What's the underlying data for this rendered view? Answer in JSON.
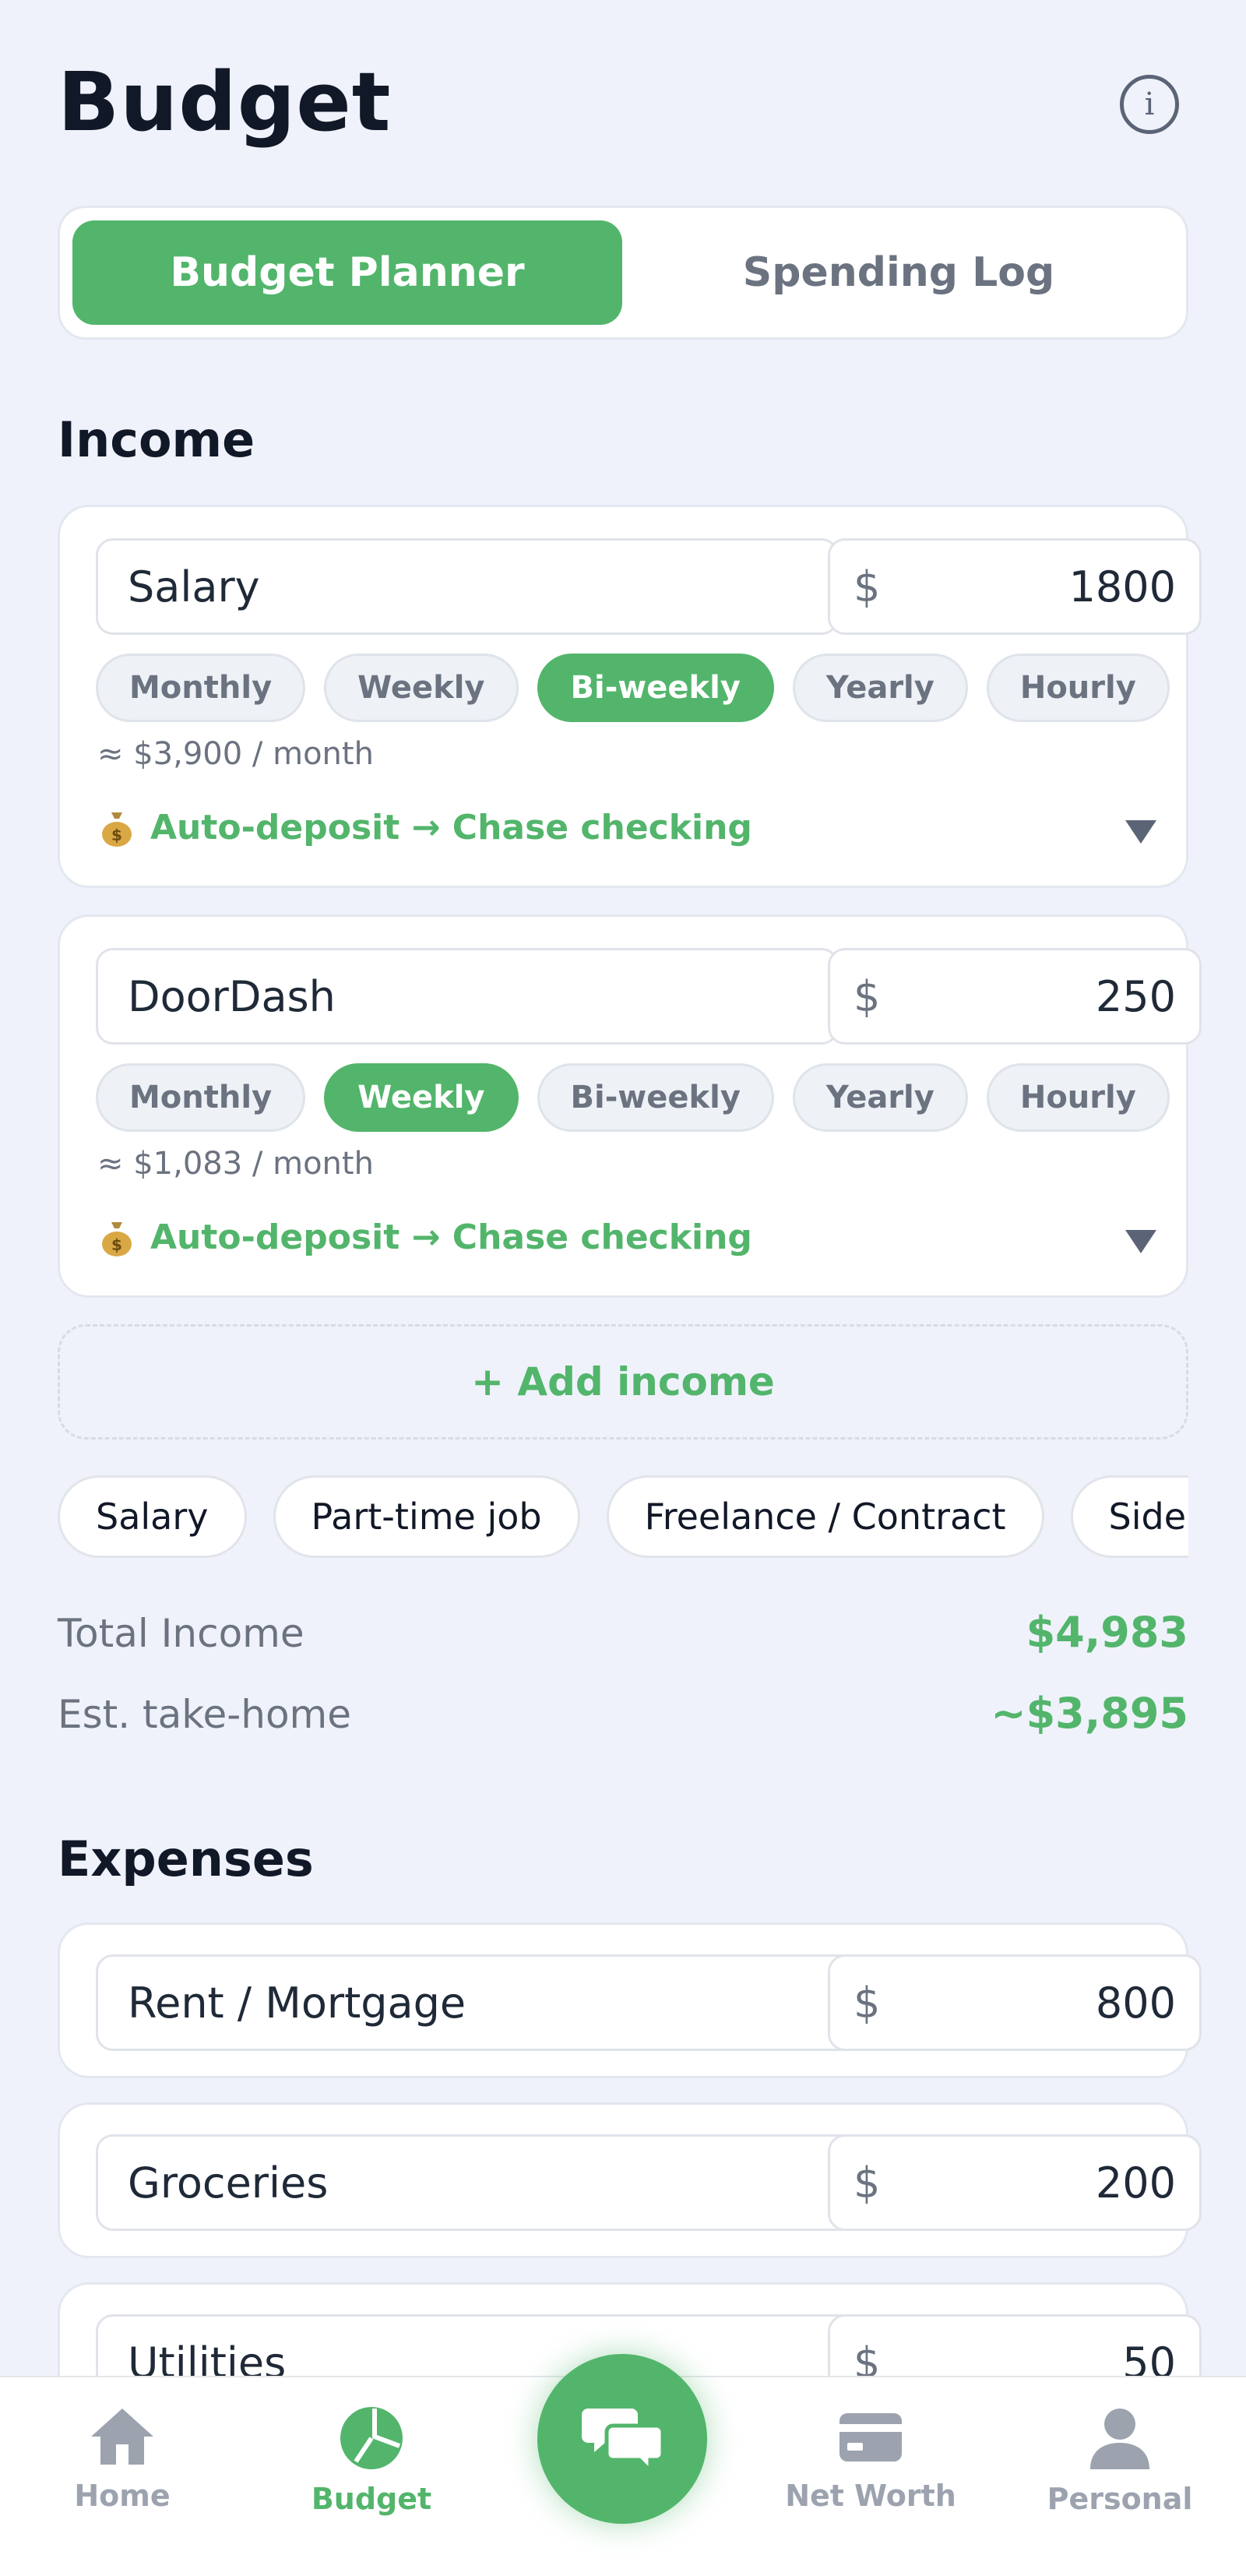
{
  "header": {
    "title": "Budget",
    "info_icon": "info-icon"
  },
  "tabs": {
    "active_label": "Budget Planner",
    "inactive_label": "Spending Log"
  },
  "income": {
    "heading": "Income",
    "frequencies": [
      "Monthly",
      "Weekly",
      "Bi-weekly",
      "Yearly",
      "Hourly"
    ],
    "entries": [
      {
        "name": "Salary",
        "currency": "$",
        "amount": "1800",
        "selected_frequency": "Bi-weekly",
        "approx": "≈ $3,900 / month",
        "deposit": "Auto-deposit → Chase checking"
      },
      {
        "name": "DoorDash",
        "currency": "$",
        "amount": "250",
        "selected_frequency": "Weekly",
        "approx": "≈ $1,083 / month",
        "deposit": "Auto-deposit → Chase checking"
      }
    ],
    "add_label": "+ Add income",
    "suggestions": [
      "Salary",
      "Part-time job",
      "Freelance / Contract",
      "Side hustle"
    ],
    "total_label": "Total Income",
    "total_value": "$4,983",
    "takehome_label": "Est. take-home",
    "takehome_value": "~$3,895"
  },
  "expenses": {
    "heading": "Expenses",
    "items": [
      {
        "name": "Rent / Mortgage",
        "currency": "$",
        "amount": "800"
      },
      {
        "name": "Groceries",
        "currency": "$",
        "amount": "200"
      },
      {
        "name": "Utilities",
        "currency": "$",
        "amount": "50"
      }
    ]
  },
  "nav": {
    "items": [
      {
        "label": "Home",
        "icon": "home-icon"
      },
      {
        "label": "Budget",
        "icon": "pie-chart-icon"
      },
      {
        "label": "Net Worth",
        "icon": "wallet-card-icon"
      },
      {
        "label": "Personal",
        "icon": "person-icon"
      }
    ],
    "fab_icon": "chat-bubbles-icon"
  },
  "colors": {
    "accent": "#52b56b",
    "background": "#eff2fa",
    "text": "#111827",
    "muted": "#6b7280"
  }
}
